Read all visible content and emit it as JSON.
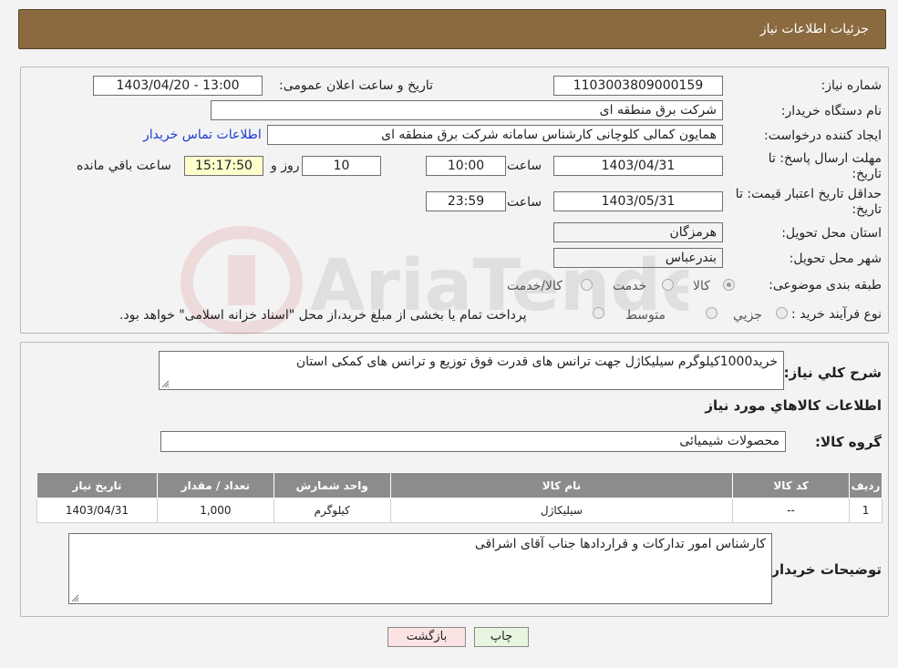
{
  "header": {
    "title": "جزئیات اطلاعات نیاز"
  },
  "form": {
    "need_number_label": "شماره نیاز:",
    "need_number": "1103003809000159",
    "announce_label": "تاریخ و ساعت اعلان عمومی:",
    "announce_value": "1403/04/20 - 13:00",
    "buyer_org_label": "نام دستگاه خریدار:",
    "buyer_org": "شرکت برق منطقه ای",
    "creator_label": "ایجاد کننده درخواست:",
    "creator": "همایون کمالی کلوچانی کارشناس سامانه شرکت برق منطقه ای",
    "contact_link": "اطلاعات تماس خریدار",
    "deadline_label": "مهلت ارسال پاسخ: تا تاریخ:",
    "deadline_date": "1403/04/31",
    "time_label": "ساعت",
    "deadline_time": "10:00",
    "days_value": "10",
    "days_label": "روز و",
    "remaining_time": "15:17:50",
    "remaining_label": "ساعت باقي مانده",
    "validity_label": "حداقل تاریخ اعتبار قیمت: تا تاریخ:",
    "validity_date": "1403/05/31",
    "validity_time": "23:59",
    "province_label": "استان محل تحویل:",
    "province": "هرمزگان",
    "city_label": "شهر محل تحویل:",
    "city": "بندرعباس",
    "category_label": "طبقه بندی موضوعی:",
    "category_options": [
      "کالا",
      "خدمت",
      "کالا/خدمت"
    ],
    "process_label": "نوع فرآیند خرید :",
    "process_options": [
      "جزیي",
      "متوسط"
    ],
    "process_note": "پرداخت تمام یا بخشی از مبلغ خرید،از محل \"اسناد خزانه اسلامی\" خواهد بود."
  },
  "summary": {
    "desc_label": "شرح كلي نياز:",
    "desc": "خرید1000کیلوگرم سیلیکاژل جهت ترانس های قدرت فوق توزیع و ترانس های کمکی استان",
    "items_title": "اطلاعات کالاهاي مورد نياز",
    "group_label": "گروه کالا:",
    "group": "محصولات شیمیائی",
    "table": {
      "headers": [
        "ردیف",
        "کد کالا",
        "نام کالا",
        "واحد شمارش",
        "تعداد / مقدار",
        "تاریخ نیاز"
      ],
      "rows": [
        [
          "1",
          "--",
          "سیلیکاژل",
          "کیلوگرم",
          "1,000",
          "1403/04/31"
        ]
      ]
    },
    "notes_label": "توضیحات خریدار:",
    "notes": "کارشناس امور تدارکات و قراردادها جناب آقای اشراقی"
  },
  "buttons": {
    "print": "چاپ",
    "back": "بازگشت"
  },
  "colors": {
    "header_bg": "#8c6a3f",
    "table_header": "#8c8c8c",
    "link": "#1a3bd6"
  }
}
